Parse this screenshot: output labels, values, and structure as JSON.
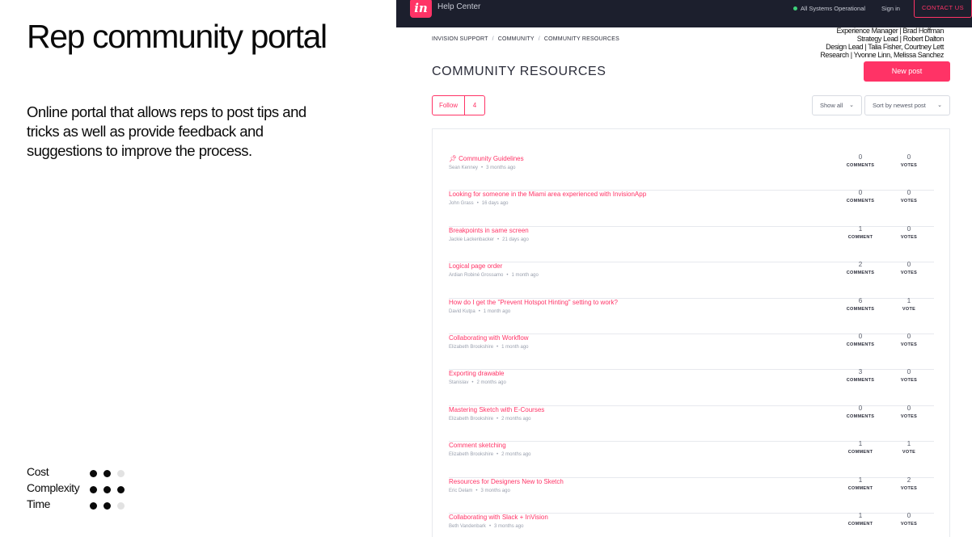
{
  "left": {
    "title": "Rep community portal",
    "description": "Online portal that allows reps to post tips and tricks as well as provide feedback and suggestions to improve the process.",
    "metrics": [
      {
        "label": "Cost",
        "level": 2,
        "max": 3
      },
      {
        "label": "Complexity",
        "level": 3,
        "max": 3
      },
      {
        "label": "Time",
        "level": 2,
        "max": 3
      }
    ]
  },
  "screenshot": {
    "topbar": {
      "logo_text": "in",
      "help_center": "Help Center",
      "status": "All Systems Operational",
      "status_color": "#3fd17a",
      "signin": "Sign in",
      "contact": "CONTACT US"
    },
    "breadcrumb": [
      "INVISION SUPPORT",
      "COMMUNITY",
      "COMMUNITY RESOURCES"
    ],
    "breadcrumb_sep": "/",
    "credits": [
      "Experience Manager | Brad Hoffman",
      "Strategy Lead | Robert Dalton",
      "Design Lead | Talia Fisher, Courtney Lett",
      "Research | Yvonne Linn, Melissa Sanchez"
    ],
    "page_title": "COMMUNITY RESOURCES",
    "new_post": "New post",
    "follow_label": "Follow",
    "follow_count": "4",
    "filter_show": "Show all",
    "filter_sort": "Sort by newest post",
    "posts": [
      {
        "title": "Community Guidelines",
        "pinned": true,
        "author": "Sean Kenney",
        "time": "3 months ago",
        "comments": "0",
        "comments_label": "COMMENTS",
        "votes": "0",
        "votes_label": "VOTES"
      },
      {
        "title": "Looking for someone in the Miami area experienced with InvisionApp",
        "pinned": false,
        "author": "John Grass",
        "time": "16 days ago",
        "comments": "0",
        "comments_label": "COMMENTS",
        "votes": "0",
        "votes_label": "VOTES"
      },
      {
        "title": "Breakpoints in same screen",
        "pinned": false,
        "author": "Jackie Lackenbacker",
        "time": "21 days ago",
        "comments": "1",
        "comments_label": "COMMENT",
        "votes": "0",
        "votes_label": "VOTES"
      },
      {
        "title": "Logical page order",
        "pinned": false,
        "author": "Ardian Robiné Grossamo",
        "time": "1 month ago",
        "comments": "2",
        "comments_label": "COMMENTS",
        "votes": "0",
        "votes_label": "VOTES"
      },
      {
        "title": "How do I get the \"Prevent Hotspot Hinting\" setting to work?",
        "pinned": false,
        "author": "David Kutpa",
        "time": "1 month ago",
        "comments": "6",
        "comments_label": "COMMENTS",
        "votes": "1",
        "votes_label": "VOTE"
      },
      {
        "title": "Collaborating with Workflow",
        "pinned": false,
        "author": "Elizabeth Brookshire",
        "time": "1 month ago",
        "comments": "0",
        "comments_label": "COMMENTS",
        "votes": "0",
        "votes_label": "VOTES"
      },
      {
        "title": "Exporting drawable",
        "pinned": false,
        "author": "Stanislav",
        "time": "2 months ago",
        "comments": "3",
        "comments_label": "COMMENTS",
        "votes": "0",
        "votes_label": "VOTES"
      },
      {
        "title": "Mastering Sketch with E-Courses",
        "pinned": false,
        "author": "Elizabeth Brookshire",
        "time": "2 months ago",
        "comments": "0",
        "comments_label": "COMMENTS",
        "votes": "0",
        "votes_label": "VOTES"
      },
      {
        "title": "Comment sketching",
        "pinned": false,
        "author": "Elizabeth Brookshire",
        "time": "2 months ago",
        "comments": "1",
        "comments_label": "COMMENT",
        "votes": "1",
        "votes_label": "VOTE"
      },
      {
        "title": "Resources for Designers New to Sketch",
        "pinned": false,
        "author": "Eric Delam",
        "time": "3 months ago",
        "comments": "1",
        "comments_label": "COMMENT",
        "votes": "2",
        "votes_label": "VOTES"
      },
      {
        "title": "Collaborating with Slack + InVision",
        "pinned": false,
        "author": "Beth Vandenbark",
        "time": "3 months ago",
        "comments": "1",
        "comments_label": "COMMENT",
        "votes": "0",
        "votes_label": "VOTES"
      }
    ]
  },
  "colors": {
    "accent": "#ff3366",
    "topbar": "#1c1f2d"
  }
}
